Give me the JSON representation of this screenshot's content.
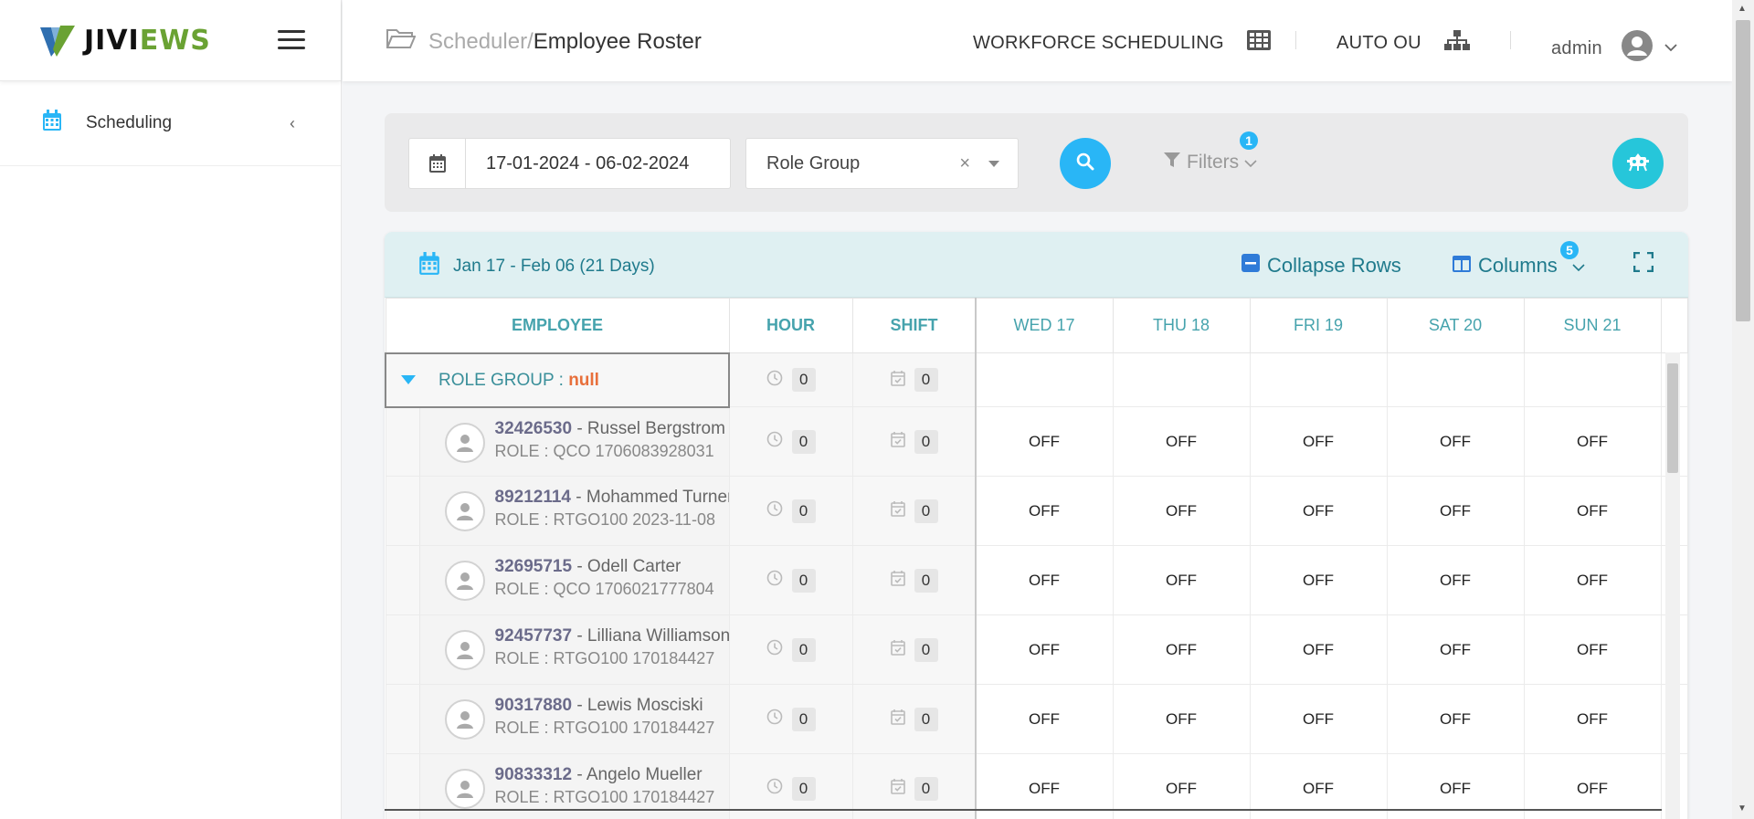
{
  "app": {
    "logo_part1": "JIVI",
    "logo_part2": "EWS"
  },
  "sidebar": {
    "items": [
      {
        "label": "Scheduling",
        "icon": "calendar-icon"
      }
    ]
  },
  "header": {
    "breadcrumb_parent": "Scheduler/",
    "breadcrumb_current": "Employee Roster",
    "module": "WORKFORCE SCHEDULING",
    "ou": "AUTO OU",
    "user": "admin"
  },
  "filterbar": {
    "date_range": "17-01-2024 - 06-02-2024",
    "role_group": "Role Group",
    "filters_label": "Filters",
    "filters_count": "1"
  },
  "roster": {
    "range_label": "Jan 17 - Feb 06 (21 Days)",
    "collapse_label": "Collapse Rows",
    "columns_label": "Columns",
    "columns_count": "5",
    "headers": {
      "employee": "EMPLOYEE",
      "hour": "HOUR",
      "shift": "SHIFT"
    },
    "days": [
      "WED 17",
      "THU 18",
      "FRI 19",
      "SAT 20",
      "SUN 21"
    ],
    "group": {
      "label": "ROLE GROUP : ",
      "value": "null",
      "hours": "0",
      "shifts": "0"
    },
    "employees": [
      {
        "id": "32426530",
        "name": " - Russel Bergstrom",
        "role": "ROLE : QCO 1706083928031",
        "hours": "0",
        "shifts": "0",
        "days": [
          "OFF",
          "OFF",
          "OFF",
          "OFF",
          "OFF"
        ]
      },
      {
        "id": "89212114",
        "name": " - Mohammed Turner",
        "role": "ROLE : RTGO100 2023-11-08",
        "hours": "0",
        "shifts": "0",
        "days": [
          "OFF",
          "OFF",
          "OFF",
          "OFF",
          "OFF"
        ]
      },
      {
        "id": "32695715",
        "name": " - Odell Carter",
        "role": "ROLE : QCO 1706021777804",
        "hours": "0",
        "shifts": "0",
        "days": [
          "OFF",
          "OFF",
          "OFF",
          "OFF",
          "OFF"
        ]
      },
      {
        "id": "92457737",
        "name": " - Lilliana Williamson",
        "role": "ROLE : RTGO100 170184427",
        "hours": "0",
        "shifts": "0",
        "days": [
          "OFF",
          "OFF",
          "OFF",
          "OFF",
          "OFF"
        ]
      },
      {
        "id": "90317880",
        "name": " - Lewis Mosciski",
        "role": "ROLE : RTGO100 170184427",
        "hours": "0",
        "shifts": "0",
        "days": [
          "OFF",
          "OFF",
          "OFF",
          "OFF",
          "OFF"
        ]
      },
      {
        "id": "90833312",
        "name": " - Angelo Mueller",
        "role": "ROLE : RTGO100 170184427",
        "hours": "0",
        "shifts": "0",
        "days": [
          "OFF",
          "OFF",
          "OFF",
          "OFF",
          "OFF"
        ]
      }
    ]
  },
  "colors": {
    "accent": "#29b6f6",
    "teal": "#26c6da",
    "header_teal": "#46a3ad",
    "null_orange": "#e8703c",
    "logo_green": "#6aa233"
  }
}
